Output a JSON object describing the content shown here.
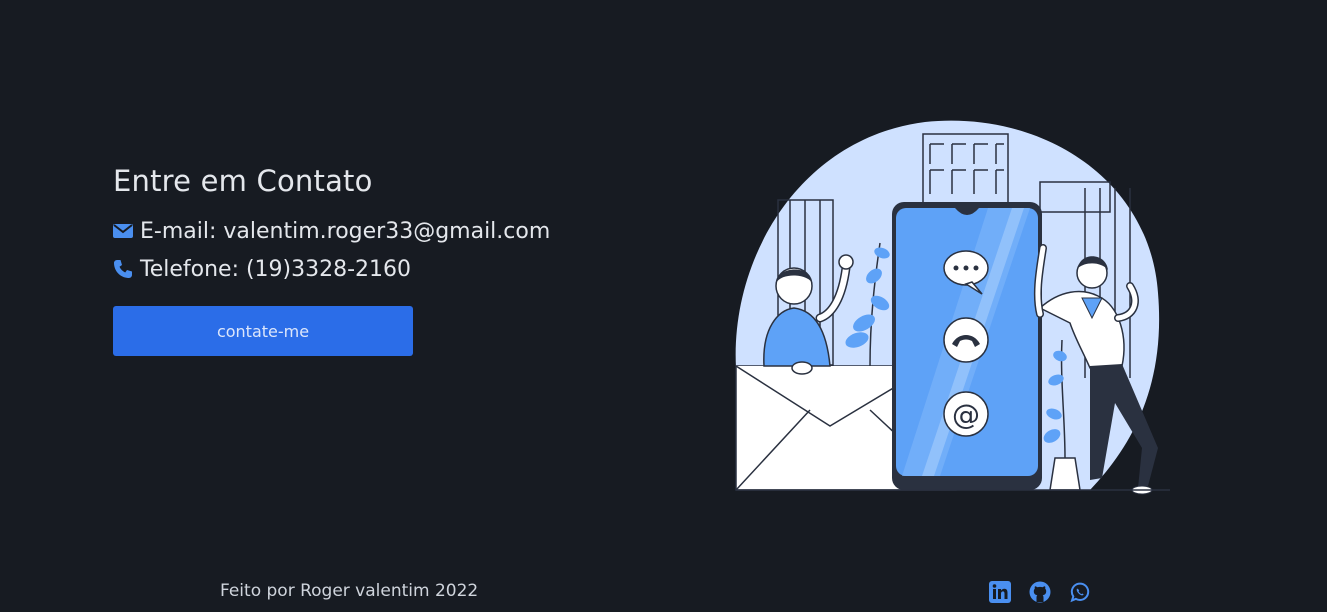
{
  "contact": {
    "title": "Entre em Contato",
    "email_text": "E-mail: valentim.roger33@gmail.com",
    "phone_text": "Telefone: (19)3328-2160",
    "button_label": "contate-me"
  },
  "footer": {
    "credit": "Feito por Roger valentim 2022",
    "social_icons": [
      "linkedin-icon",
      "github-icon",
      "whatsapp-icon"
    ]
  },
  "colors": {
    "background": "#171b22",
    "accent": "#2b6de8",
    "icon_blue": "#4a8ff0",
    "illustration_blue": "#5ea2f7",
    "illustration_light": "#cfe1ff"
  },
  "illustration": {
    "icons": [
      "chat-bubble-icon",
      "phone-handset-icon",
      "at-sign-icon",
      "envelope-icon"
    ]
  }
}
